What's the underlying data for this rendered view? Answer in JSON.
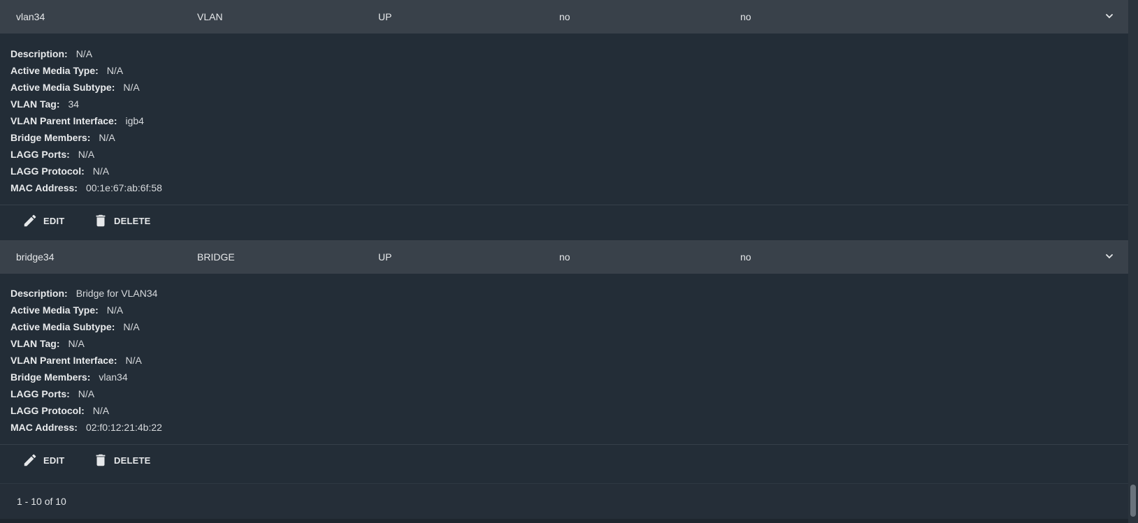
{
  "rows": [
    {
      "name": "vlan34",
      "type": "VLAN",
      "link_state": "UP",
      "dhcp": "no",
      "ipv6_autoconfigure": "no",
      "details": [
        {
          "label": "Description:",
          "value": "N/A"
        },
        {
          "label": "Active Media Type:",
          "value": "N/A"
        },
        {
          "label": "Active Media Subtype:",
          "value": "N/A"
        },
        {
          "label": "VLAN Tag:",
          "value": "34"
        },
        {
          "label": "VLAN Parent Interface:",
          "value": "igb4"
        },
        {
          "label": "Bridge Members:",
          "value": "N/A"
        },
        {
          "label": "LAGG Ports:",
          "value": "N/A"
        },
        {
          "label": "LAGG Protocol:",
          "value": "N/A"
        },
        {
          "label": "MAC Address:",
          "value": "00:1e:67:ab:6f:58"
        }
      ],
      "actions": {
        "edit": "EDIT",
        "delete": "DELETE"
      }
    },
    {
      "name": "bridge34",
      "type": "BRIDGE",
      "link_state": "UP",
      "dhcp": "no",
      "ipv6_autoconfigure": "no",
      "details": [
        {
          "label": "Description:",
          "value": "Bridge for VLAN34"
        },
        {
          "label": "Active Media Type:",
          "value": "N/A"
        },
        {
          "label": "Active Media Subtype:",
          "value": "N/A"
        },
        {
          "label": "VLAN Tag:",
          "value": "N/A"
        },
        {
          "label": "VLAN Parent Interface:",
          "value": "N/A"
        },
        {
          "label": "Bridge Members:",
          "value": "vlan34"
        },
        {
          "label": "LAGG Ports:",
          "value": "N/A"
        },
        {
          "label": "LAGG Protocol:",
          "value": "N/A"
        },
        {
          "label": "MAC Address:",
          "value": "02:f0:12:21:4b:22"
        }
      ],
      "actions": {
        "edit": "EDIT",
        "delete": "DELETE"
      }
    }
  ],
  "footer": {
    "pagination": "1 - 10 of 10"
  },
  "icons": {
    "edit": "pencil-icon",
    "delete": "trash-icon",
    "expand": "chevron-down-icon"
  },
  "colors": {
    "header_bg": "#39414a",
    "detail_bg": "#232d37",
    "page_bg": "#222b35"
  }
}
